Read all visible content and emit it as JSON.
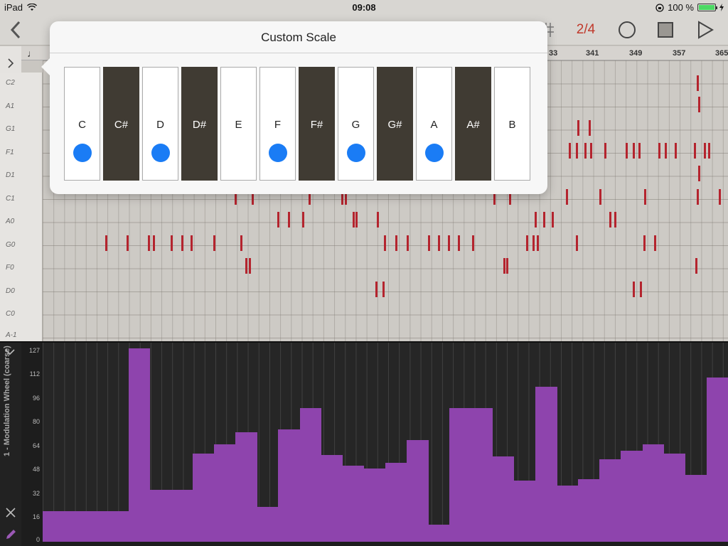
{
  "status": {
    "device": "iPad",
    "time": "09:08",
    "battery": "100 %"
  },
  "toolbar": {
    "page_indicator": "2/4",
    "back_icon": "chevron-left-icon",
    "grid_icon": "grid-icon",
    "record_icon": "circle-icon",
    "stop_icon": "square-icon",
    "play_icon": "play-icon",
    "colors": {
      "accent": "#c0392b"
    }
  },
  "ruler": {
    "bars": [
      "33",
      "341",
      "349",
      "357",
      "365"
    ]
  },
  "piano_roll": {
    "note_labels": [
      "C2",
      "A1",
      "G1",
      "F1",
      "D1",
      "C1",
      "A0",
      "G0",
      "F0",
      "D0",
      "C0",
      "A-1"
    ],
    "note_color": "#b4242e"
  },
  "controller": {
    "title": "1 - Modulation Wheel (coarse)",
    "scale": [
      "127",
      "112",
      "96",
      "80",
      "64",
      "48",
      "32",
      "16",
      "0"
    ],
    "bar_color": "#8e44ad",
    "values": [
      20,
      20,
      20,
      20,
      20,
      20,
      20,
      20,
      127,
      127,
      34,
      34,
      34,
      34,
      58,
      58,
      64,
      64,
      72,
      72,
      23,
      23,
      74,
      74,
      88,
      88,
      57,
      57,
      50,
      50,
      48,
      48,
      52,
      52,
      67,
      67,
      11,
      11,
      88,
      88,
      88,
      88,
      56,
      56,
      40,
      40,
      102,
      102,
      37,
      37,
      41,
      41,
      54,
      54,
      60,
      60,
      64,
      64,
      58,
      58,
      44,
      44,
      108,
      108
    ]
  },
  "popover": {
    "title": "Custom Scale",
    "keys": [
      {
        "name": "C",
        "black": false,
        "selected": true
      },
      {
        "name": "C#",
        "black": true,
        "selected": false
      },
      {
        "name": "D",
        "black": false,
        "selected": true
      },
      {
        "name": "D#",
        "black": true,
        "selected": false
      },
      {
        "name": "E",
        "black": false,
        "selected": false
      },
      {
        "name": "F",
        "black": false,
        "selected": true
      },
      {
        "name": "F#",
        "black": true,
        "selected": false
      },
      {
        "name": "G",
        "black": false,
        "selected": true
      },
      {
        "name": "G#",
        "black": true,
        "selected": false
      },
      {
        "name": "A",
        "black": false,
        "selected": true
      },
      {
        "name": "A#",
        "black": true,
        "selected": false
      },
      {
        "name": "B",
        "black": false,
        "selected": false
      }
    ],
    "dot_color": "#1a7cf5"
  }
}
